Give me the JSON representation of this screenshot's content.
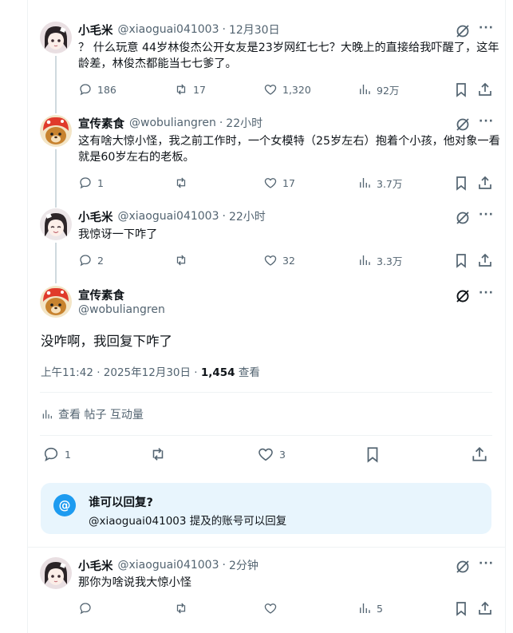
{
  "posts": [
    {
      "name": "小毛米",
      "handle": "@xiaoguai041003",
      "dot": "·",
      "time": "12月30日",
      "text": "？ 什么玩意 44岁林俊杰公开女友是23岁网红七七？大晚上的直接给我吓醒了，这年龄差，林俊杰都能当七七爹了。",
      "replies": "186",
      "reposts": "17",
      "likes": "1,320",
      "views": "92万"
    },
    {
      "name": "宣传素食",
      "handle": "@wobuliangren",
      "dot": "·",
      "time": "22小时",
      "text": "这有啥大惊小怪，我之前工作时，一个女模特（25岁左右）抱着个小孩，他对象一看就是60岁左右的老板。",
      "replies": "1",
      "reposts": "",
      "likes": "17",
      "views": "3.7万"
    },
    {
      "name": "小毛米",
      "handle": "@xiaoguai041003",
      "dot": "·",
      "time": "22小时",
      "text": "我惊讶一下咋了",
      "replies": "2",
      "reposts": "",
      "likes": "32",
      "views": "3.3万"
    }
  ],
  "main": {
    "name": "宣传素食",
    "handle": "@wobuliangren",
    "text": "没咋啊，我回复下咋了",
    "timestamp": "上午11:42 · 2025年12月30日 · ",
    "view_count": "1,454",
    "view_label": " 查看",
    "engagement_label": "查看 帖子 互动量",
    "replies": "1",
    "likes": "3"
  },
  "reply_restriction": {
    "title": "谁可以回复?",
    "desc": "@xiaoguai041003 提及的账号可以回复",
    "icon": "@"
  },
  "reply": {
    "name": "小毛米",
    "handle": "@xiaoguai041003",
    "dot": "·",
    "time": "2分钟",
    "text": "那你为啥说我大惊小怪",
    "views": "5"
  },
  "colors": {
    "text_primary": "#0f1419",
    "text_secondary": "#536471",
    "accent": "#1d9bf0",
    "reply_box_bg": "#e8f5fd"
  }
}
